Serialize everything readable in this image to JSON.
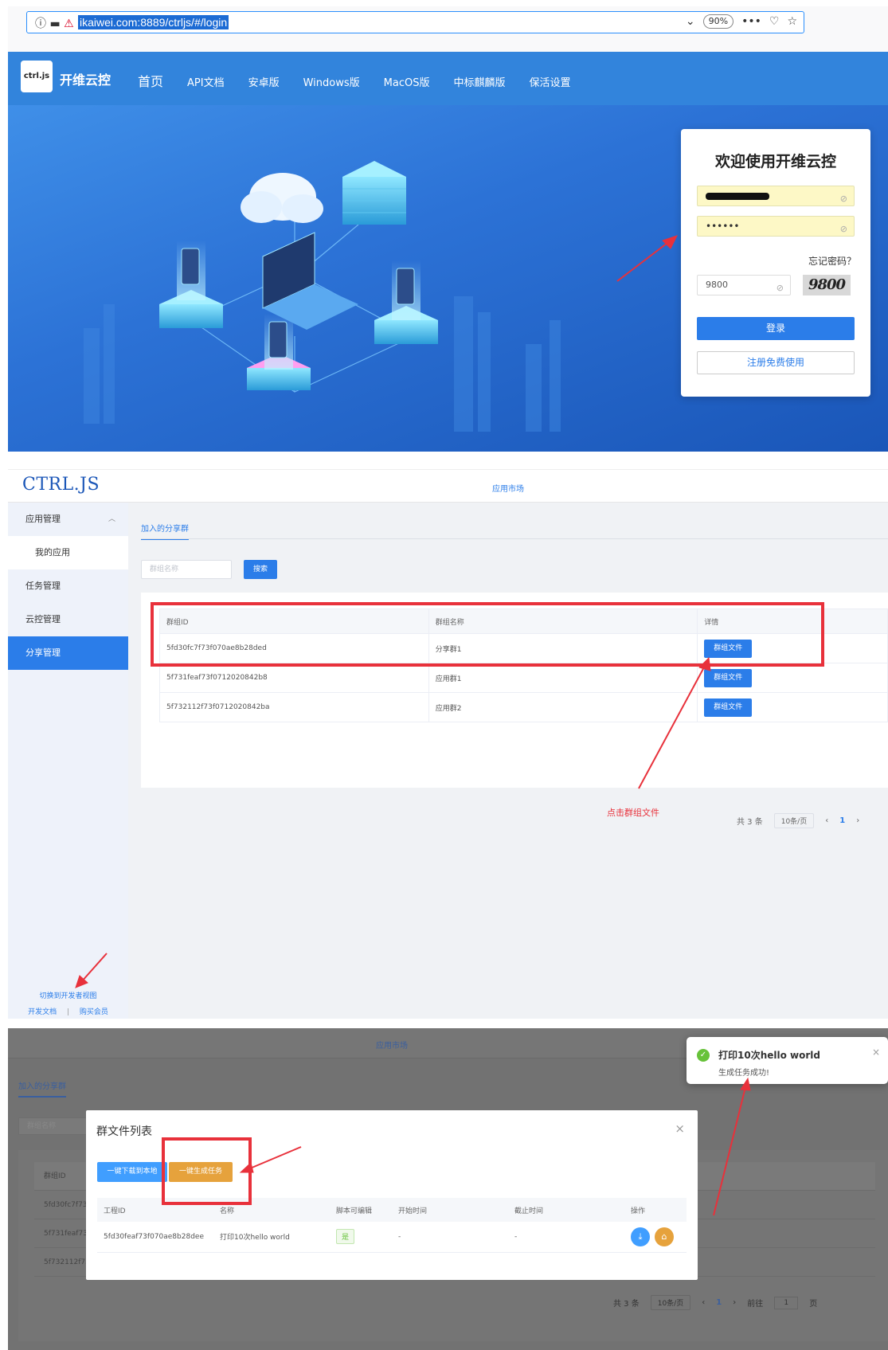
{
  "browser": {
    "url": "ikaiwei.com:8889/ctrljs/#/login",
    "zoom": "90%",
    "icons": [
      "info-icon",
      "reader-icon",
      "insecure-icon",
      "chevron-down-icon",
      "more-icon",
      "pocket-icon",
      "star-icon"
    ]
  },
  "site": {
    "logo_text": "ctrl.js",
    "name": "开维云控",
    "nav": [
      "首页",
      "API文档",
      "安卓版",
      "Windows版",
      "MacOS版",
      "中标麒麟版",
      "保活设置"
    ]
  },
  "login": {
    "title": "欢迎使用开维云控",
    "username_value": "",
    "password_value": "••••••",
    "forgot": "忘记密码？",
    "captcha_value": "9800",
    "captcha_image_text": "9800",
    "login_button": "登录",
    "register_button": "注册免费使用"
  },
  "admin": {
    "logo": "CTRL.JS",
    "market": "应用市场",
    "sidebar": {
      "app_manage": "应用管理",
      "my_apps": "我的应用",
      "task_manage": "任务管理",
      "cloud_manage": "云控管理",
      "share_manage": "分享管理",
      "dev_view": "切换到开发者视图",
      "dev_docs": "开发文档",
      "buy_member": "购买会员",
      "separator": "|"
    },
    "tab": "加入的分享群",
    "search_placeholder": "群组名称",
    "search_button": "搜索",
    "table": {
      "headers": [
        "群组ID",
        "群组名称",
        "详情"
      ],
      "rows": [
        {
          "id": "5fd30fc7f73f070ae8b28ded",
          "name": "分享群1",
          "action": "群组文件"
        },
        {
          "id": "5f731feaf73f0712020842b8",
          "name": "应用群1",
          "action": "群组文件"
        },
        {
          "id": "5f732112f73f0712020842ba",
          "name": "应用群2",
          "action": "群组文件"
        }
      ]
    },
    "pager": {
      "total": "共 3 条",
      "page_size": "10条/页",
      "prev": "‹",
      "current": "1",
      "next": "›"
    },
    "annotation": "点击群组文件"
  },
  "dialog_section": {
    "market": "应用市场",
    "tab": "加入的分享群",
    "search_placeholder": "群组名称",
    "bg_header": "群组ID",
    "bg_rows": [
      "5fd30fc7f73",
      "5f731feaf73",
      "5f732112f73"
    ],
    "pager": {
      "total": "共 3 条",
      "page_size": "10条/页",
      "prev": "‹",
      "current": "1",
      "next": "›",
      "goto": "前往",
      "goto_value": "1",
      "page": "页"
    },
    "dialog": {
      "title": "群文件列表",
      "download_button": "一键下载到本地",
      "gentask_button": "一键生成任务",
      "headers": [
        "工程ID",
        "名称",
        "脚本可编辑",
        "开始时间",
        "截止时间",
        "操作"
      ],
      "row": {
        "id": "5fd30feaf73f070ae8b28dee",
        "name": "打印10次hello world",
        "editable": "是",
        "start": "-",
        "end": "-"
      }
    },
    "toast": {
      "title": "打印10次hello world",
      "message": "生成任务成功!"
    }
  },
  "colors": {
    "primary": "#2b7de9",
    "header": "#3284dc",
    "annotation_red": "#e8313b",
    "warning": "#e6a23c",
    "success": "#67c23a"
  }
}
